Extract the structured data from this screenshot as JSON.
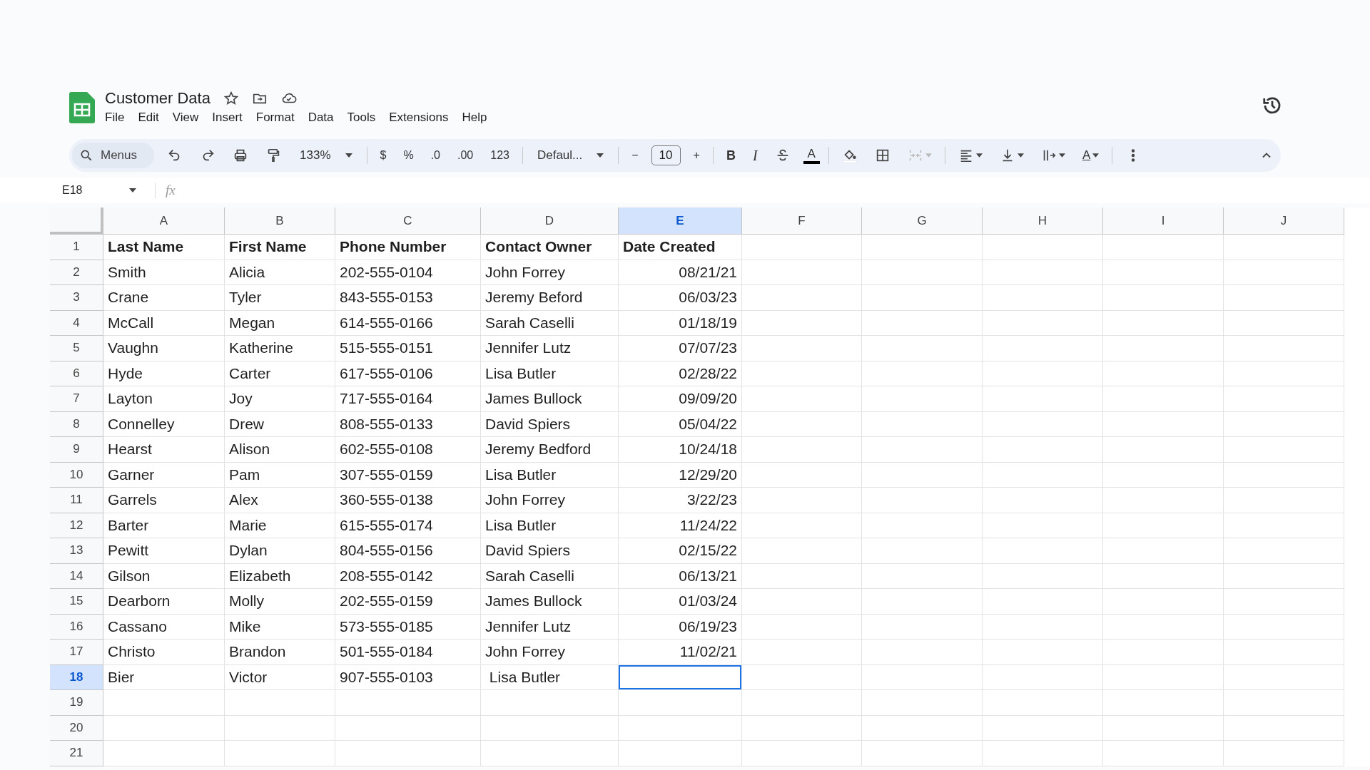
{
  "document": {
    "title": "Customer Data"
  },
  "menu": [
    "File",
    "Edit",
    "View",
    "Insert",
    "Format",
    "Data",
    "Tools",
    "Extensions",
    "Help"
  ],
  "toolbar": [
    {
      "kind": "search",
      "label": "Menus"
    },
    {
      "kind": "undo"
    },
    {
      "kind": "redo"
    },
    {
      "kind": "print"
    },
    {
      "kind": "paint"
    },
    {
      "kind": "dropdown",
      "label": "133%"
    },
    {
      "kind": "sep"
    },
    {
      "kind": "text",
      "label": "$"
    },
    {
      "kind": "text",
      "label": "%"
    },
    {
      "kind": "text",
      "label": ".0"
    },
    {
      "kind": "text",
      "label": ".00"
    },
    {
      "kind": "text",
      "label": "123"
    },
    {
      "kind": "sep"
    },
    {
      "kind": "dropdown",
      "label": "Defaul..."
    },
    {
      "kind": "sep"
    },
    {
      "kind": "text",
      "label": "−"
    },
    {
      "kind": "field",
      "value": "10"
    },
    {
      "kind": "text",
      "label": "+"
    },
    {
      "kind": "sep"
    },
    {
      "kind": "bold",
      "label": "B"
    },
    {
      "kind": "italic",
      "label": "I"
    },
    {
      "kind": "strike"
    },
    {
      "kind": "color",
      "label": "A"
    },
    {
      "kind": "sep"
    },
    {
      "kind": "fill"
    },
    {
      "kind": "borders"
    },
    {
      "kind": "merge",
      "caret": true,
      "disabled": true
    },
    {
      "kind": "sep"
    },
    {
      "kind": "align",
      "caret": true
    },
    {
      "kind": "valign",
      "caret": true
    },
    {
      "kind": "wrap",
      "caret": true
    },
    {
      "kind": "rotate",
      "label": "A",
      "caret": true
    },
    {
      "kind": "sep"
    },
    {
      "kind": "more"
    }
  ],
  "name_box": "E18",
  "formula_label": "fx",
  "columns": [
    {
      "label": "A",
      "selected": false,
      "kind": "text"
    },
    {
      "label": "B",
      "selected": false,
      "kind": "text"
    },
    {
      "label": "C",
      "selected": false,
      "kind": "text"
    },
    {
      "label": "D",
      "selected": false,
      "kind": "text"
    },
    {
      "label": "E",
      "selected": true,
      "kind": "date"
    },
    {
      "label": "F",
      "selected": false,
      "kind": "text"
    },
    {
      "label": "G",
      "selected": false,
      "kind": "text"
    },
    {
      "label": "H",
      "selected": false,
      "kind": "text"
    },
    {
      "label": "I",
      "selected": false,
      "kind": "text"
    },
    {
      "label": "J",
      "selected": false,
      "kind": "text"
    }
  ],
  "rows": [
    {
      "number": "1",
      "selected": false,
      "bold": true,
      "cells": [
        "Last Name",
        "First Name",
        "Phone Number",
        "Contact Owner",
        "Date Created"
      ]
    },
    {
      "number": "2",
      "selected": false,
      "cells": [
        "Smith",
        "Alicia",
        "202-555-0104",
        "John Forrey",
        "08/21/21"
      ]
    },
    {
      "number": "3",
      "selected": false,
      "cells": [
        "Crane",
        "Tyler",
        "843-555-0153",
        "Jeremy Beford",
        "06/03/23"
      ]
    },
    {
      "number": "4",
      "selected": false,
      "cells": [
        "McCall",
        "Megan",
        "614-555-0166",
        "Sarah Caselli",
        "01/18/19"
      ]
    },
    {
      "number": "5",
      "selected": false,
      "cells": [
        "Vaughn",
        "Katherine",
        "515-555-0151",
        "Jennifer Lutz",
        "07/07/23"
      ]
    },
    {
      "number": "6",
      "selected": false,
      "cells": [
        "Hyde",
        "Carter",
        "617-555-0106",
        "Lisa Butler",
        "02/28/22"
      ]
    },
    {
      "number": "7",
      "selected": false,
      "cells": [
        "Layton",
        "Joy",
        "717-555-0164",
        "James Bullock",
        "09/09/20"
      ]
    },
    {
      "number": "8",
      "selected": false,
      "cells": [
        "Connelley",
        "Drew",
        "808-555-0133",
        "David Spiers",
        "05/04/22"
      ]
    },
    {
      "number": "9",
      "selected": false,
      "cells": [
        "Hearst",
        "Alison",
        "602-555-0108",
        "Jeremy Bedford",
        "10/24/18"
      ]
    },
    {
      "number": "10",
      "selected": false,
      "cells": [
        "Garner",
        "Pam",
        "307-555-0159",
        "Lisa Butler",
        "12/29/20"
      ]
    },
    {
      "number": "11",
      "selected": false,
      "cells": [
        "Garrels",
        "Alex",
        "360-555-0138",
        "John Forrey",
        "3/22/23"
      ]
    },
    {
      "number": "12",
      "selected": false,
      "cells": [
        "Barter",
        "Marie",
        "615-555-0174",
        "Lisa Butler",
        "11/24/22"
      ]
    },
    {
      "number": "13",
      "selected": false,
      "cells": [
        "Pewitt",
        "Dylan",
        "804-555-0156",
        "David Spiers",
        "02/15/22"
      ]
    },
    {
      "number": "14",
      "selected": false,
      "cells": [
        "Gilson",
        "Elizabeth",
        "208-555-0142",
        "Sarah Caselli",
        "06/13/21"
      ]
    },
    {
      "number": "15",
      "selected": false,
      "cells": [
        "Dearborn",
        "Molly",
        "202-555-0159",
        "James Bullock",
        "01/03/24"
      ]
    },
    {
      "number": "16",
      "selected": false,
      "cells": [
        "Cassano",
        "Mike",
        "573-555-0185",
        "Jennifer Lutz",
        "06/19/23"
      ]
    },
    {
      "number": "17",
      "selected": false,
      "cells": [
        "Christo",
        "Brandon",
        "501-555-0184",
        "John Forrey",
        "11/02/21"
      ]
    },
    {
      "number": "18",
      "selected": true,
      "cells": [
        "Bier",
        "Victor",
        "907-555-0103",
        " Lisa Butler"
      ]
    },
    {
      "number": "19",
      "selected": false
    },
    {
      "number": "20",
      "selected": false
    },
    {
      "number": "21",
      "selected": false
    }
  ]
}
